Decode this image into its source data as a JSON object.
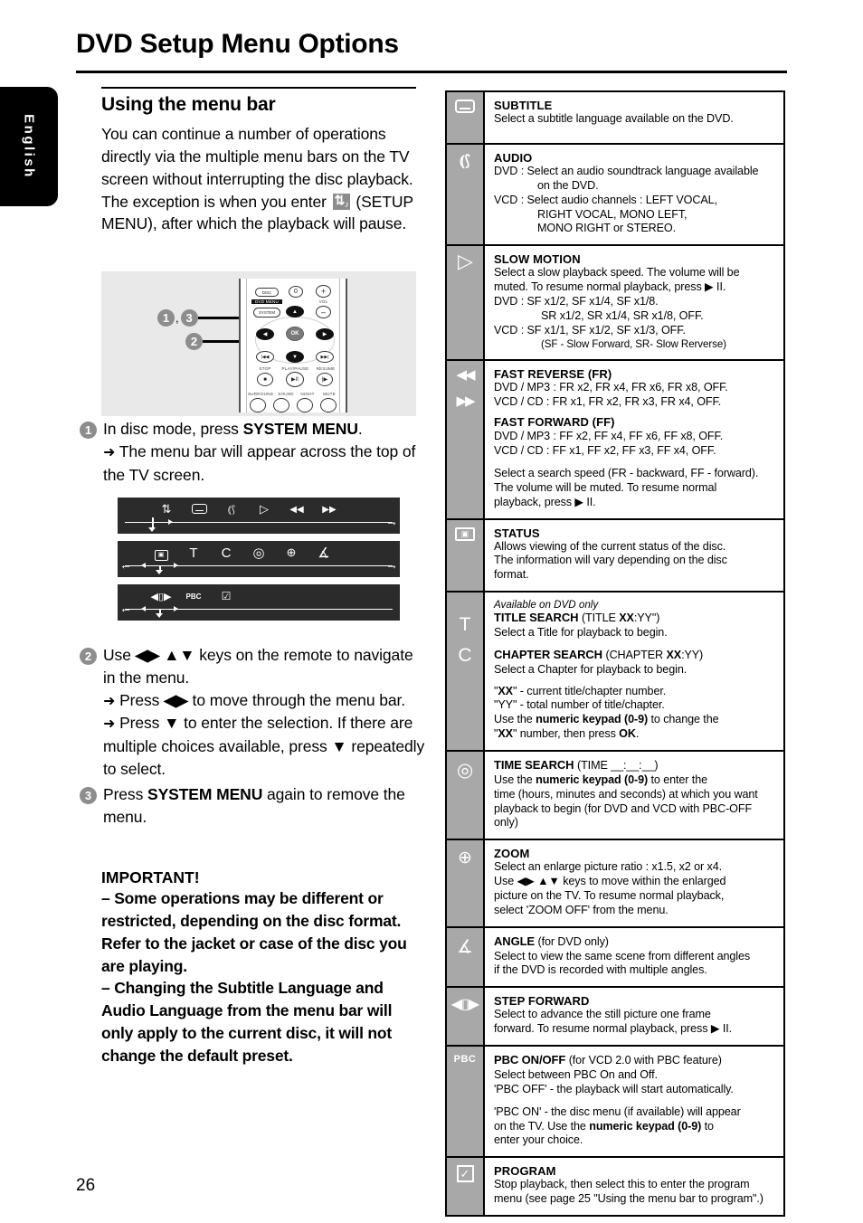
{
  "page": {
    "title": "DVD Setup Menu Options",
    "language_tab": "English",
    "page_number": "26"
  },
  "left": {
    "heading": "Using the menu bar",
    "intro_part1": "You can continue a number of operations directly via the multiple menu bars on the TV screen without interrupting the disc playback. The exception is when you enter ",
    "intro_icon": "setup-menu-icon",
    "intro_part2": " (SETUP MENU), after which the playback will pause.",
    "steps": [
      {
        "num": "1",
        "lines": [
          "In disc mode, press SYSTEM MENU.",
          "→ The menu bar will appear across the top of the TV screen."
        ],
        "line1_plain": "In disc mode, press ",
        "line1_bold": "SYSTEM MENU",
        "line1_tail": ".",
        "sub1": "The menu bar will appear across the top of the TV screen."
      },
      {
        "num": "2",
        "line1_plain": "Use ",
        "line1_keys": "◀▶ ▲▼",
        "line1_tail": " keys on the remote to navigate in the menu.",
        "sub1_plain": "Press ",
        "sub1_keys": "◀▶",
        "sub1_tail": " to move through the menu bar.",
        "sub2_plain": "Press ",
        "sub2_keys": "▼",
        "sub2_tail": " to enter the selection.  If there are multiple choices available, press ▼ repeatedly to select."
      },
      {
        "num": "3",
        "line1_plain": "Press ",
        "line1_bold": "SYSTEM MENU",
        "line1_tail": " again to remove the menu."
      }
    ],
    "important": {
      "heading": "IMPORTANT!",
      "bullets": [
        "–  Some operations may be different or restricted, depending on the disc format. Refer to the jacket or case of the disc you are playing.",
        "–  Changing the Subtitle Language and Audio Language from the menu bar will only apply to the current disc, it will not change the default preset."
      ]
    },
    "remote_figure": {
      "callout_1_3": "1, 3",
      "callout_2": "2",
      "keys": {
        "disc": "DISC",
        "dvd_menu": "DVD MENU",
        "system": "SYSTEM",
        "zero": "0",
        "vol": "VOL",
        "vol_plus": "+",
        "vol_minus": "–",
        "ok": "OK",
        "up": "▲",
        "down": "▼",
        "left": "◀",
        "right": "▶",
        "prev": "|◀◀",
        "next": "▶▶|",
        "stop_label": "STOP",
        "play_label": "PLAY/PAUSE",
        "resume_label": "RESUME",
        "stop": "■",
        "playpause": "▶II",
        "resume": "|▶",
        "surround": "SURROUND",
        "sound": "SOUND",
        "night": "NIGHT",
        "mute": "MUTE"
      }
    },
    "menu_bars": [
      {
        "icons": [
          "setup-menu-icon",
          "subtitle-icon",
          "audio-icon",
          "slow-motion-icon",
          "fast-reverse-icon",
          "fast-forward-icon"
        ],
        "glyphs": [
          "⇅",
          "▭",
          "((",
          "▷",
          "◀◀",
          "▶▶"
        ]
      },
      {
        "icons": [
          "status-icon",
          "title-search-icon",
          "chapter-search-icon",
          "time-search-icon",
          "zoom-icon",
          "angle-icon"
        ],
        "glyphs": [
          "◻",
          "T",
          "C",
          "◎",
          "⊕",
          "∡"
        ]
      },
      {
        "icons": [
          "step-forward-icon",
          "pbc-icon",
          "program-icon"
        ],
        "glyphs": [
          "◀▯▶",
          "PBC",
          "☑"
        ]
      }
    ]
  },
  "table": {
    "rows": [
      {
        "icons": [
          "subtitle-icon"
        ],
        "title": "SUBTITLE",
        "body": [
          {
            "type": "text",
            "text": "Select a subtitle language available on the DVD."
          }
        ]
      },
      {
        "icons": [
          "audio-icon"
        ],
        "title": "AUDIO",
        "body": [
          {
            "type": "text",
            "text": "DVD :  Select an audio soundtrack language available"
          },
          {
            "type": "indent",
            "text": "on the DVD."
          },
          {
            "type": "text",
            "text": "VCD :  Select audio channels : LEFT VOCAL,"
          },
          {
            "type": "indent",
            "text": "RIGHT VOCAL, MONO LEFT,"
          },
          {
            "type": "indent",
            "text": "MONO RIGHT or STEREO."
          }
        ]
      },
      {
        "icons": [
          "slow-motion-icon"
        ],
        "title": "SLOW MOTION",
        "body": [
          {
            "type": "text",
            "text": "Select a slow playback speed. The volume will be"
          },
          {
            "type": "text",
            "text": "muted.  To resume normal playback, press ▶ II."
          },
          {
            "type": "text",
            "text": "DVD :  SF x1/2, SF x1/4, SF x1/8."
          },
          {
            "type": "indent2",
            "text": "SR x1/2, SR x1/4, SR x1/8, OFF."
          },
          {
            "type": "text",
            "text": "VCD :  SF x1/1, SF x1/2, SF x1/3, OFF."
          },
          {
            "type": "indent3",
            "text": "(SF - Slow Forward, SR- Slow Rerverse)"
          }
        ]
      },
      {
        "icons": [
          "fast-reverse-icon",
          "fast-forward-icon"
        ],
        "title": "FAST REVERSE (FR)",
        "body": [
          {
            "type": "text",
            "text": "DVD / MP3 : FR x2, FR x4, FR x6, FR x8, OFF."
          },
          {
            "type": "text",
            "text": "VCD / CD : FR x1, FR x2, FR x3, FR x4, OFF."
          },
          {
            "type": "title",
            "text": "FAST FORWARD (FF)"
          },
          {
            "type": "text",
            "text": "DVD / MP3 : FF x2, FF x4, FF x6, FF x8, OFF."
          },
          {
            "type": "text",
            "text": "VCD / CD : FF x1, FF x2, FF x3, FF x4, OFF."
          },
          {
            "type": "gap",
            "text": ""
          },
          {
            "type": "text",
            "text": "Select a search speed (FR - backward, FF - forward)."
          },
          {
            "type": "text",
            "text": "The volume will be muted.  To resume normal"
          },
          {
            "type": "text",
            "text": "playback, press ▶ II."
          }
        ]
      },
      {
        "icons": [
          "status-icon"
        ],
        "title": "STATUS",
        "body": [
          {
            "type": "text",
            "text": "Allows viewing of the current status of the disc."
          },
          {
            "type": "text",
            "text": "The information will vary depending on the disc"
          },
          {
            "type": "text",
            "text": "format."
          }
        ]
      },
      {
        "icons": [
          "title-search-icon",
          "chapter-search-icon"
        ],
        "pretitle": "Available on DVD only",
        "title": "TITLE SEARCH (TITLE XX:YY\")",
        "title_html": "<b>TITLE SEARCH </b>(TITLE <b>XX</b>:YY\")",
        "body": [
          {
            "type": "text",
            "text": "Select a Title for playback to begin."
          },
          {
            "type": "gap",
            "text": ""
          },
          {
            "type": "html",
            "text": "<b>CHAPTER SEARCH </b>(CHAPTER <b>XX</b>:YY)"
          },
          {
            "type": "text",
            "text": "Select a Chapter for playback to begin."
          },
          {
            "type": "gap",
            "text": ""
          },
          {
            "type": "html",
            "text": "\"<b>XX</b>\" - current title/chapter number."
          },
          {
            "type": "text",
            "text": "\"YY\" - total number of title/chapter."
          },
          {
            "type": "html",
            "text": "Use the <b>numeric keypad (0-9)</b> to change the"
          },
          {
            "type": "html",
            "text": "\"<b>XX</b>\" number, then press <b>OK</b>."
          }
        ]
      },
      {
        "icons": [
          "time-search-icon"
        ],
        "title_html": "<b>TIME SEARCH </b>(TIME __:__:__)",
        "title": "TIME SEARCH (TIME __:__:__)",
        "body": [
          {
            "type": "html",
            "text": "Use the <b>numeric keypad (0-9)</b> to enter the"
          },
          {
            "type": "text",
            "text": "time (hours, minutes and seconds) at which you want"
          },
          {
            "type": "text",
            "text": "playback to begin (for DVD and VCD with PBC-OFF"
          },
          {
            "type": "text",
            "text": "only)"
          }
        ]
      },
      {
        "icons": [
          "zoom-icon"
        ],
        "title": "ZOOM",
        "body": [
          {
            "type": "text",
            "text": "Select an enlarge picture ratio : x1.5, x2 or x4."
          },
          {
            "type": "text",
            "text": "Use ◀▶ ▲▼ keys to move within the enlarged"
          },
          {
            "type": "text",
            "text": "picture on the TV. To resume normal playback,"
          },
          {
            "type": "text",
            "text": "select 'ZOOM OFF' from the menu."
          }
        ]
      },
      {
        "icons": [
          "angle-icon"
        ],
        "title_html": "<b>ANGLE </b>(for DVD only)",
        "title": "ANGLE (for DVD only)",
        "body": [
          {
            "type": "text",
            "text": "Select to view the same scene from different angles"
          },
          {
            "type": "text",
            "text": "if the DVD is recorded with multiple angles."
          }
        ]
      },
      {
        "icons": [
          "step-forward-icon"
        ],
        "title": "STEP FORWARD",
        "body": [
          {
            "type": "text",
            "text": "Select to advance the still picture one frame"
          },
          {
            "type": "text",
            "text": "forward. To resume normal playback, press ▶ II."
          }
        ]
      },
      {
        "icons": [
          "pbc-icon"
        ],
        "title_html": "<b>PBC ON/OFF </b>(for VCD 2.0 with PBC feature)",
        "title": "PBC ON/OFF (for VCD 2.0 with PBC feature)",
        "body": [
          {
            "type": "text",
            "text": "Select between PBC On and Off."
          },
          {
            "type": "text",
            "text": "'PBC OFF' - the playback will start automatically."
          },
          {
            "type": "gap",
            "text": ""
          },
          {
            "type": "text",
            "text": "'PBC ON' - the disc menu (if available) will appear"
          },
          {
            "type": "html",
            "text": "on the TV. Use the <b>numeric keypad (0-9)</b> to"
          },
          {
            "type": "text",
            "text": "enter your choice."
          }
        ]
      },
      {
        "icons": [
          "program-icon"
        ],
        "title": "PROGRAM",
        "body": [
          {
            "type": "text",
            "text": "Stop playback, then select this to enter the program"
          },
          {
            "type": "text",
            "text": "menu (see page 25 \"Using the menu bar to program\".)"
          }
        ]
      }
    ]
  },
  "colors": {
    "icon_column_bg": "#a8a8a8",
    "menu_bar_bg": "#2b2b2b",
    "bullet_gray": "#8d8d8d",
    "figure_bg": "#e9e9e9",
    "tab_black": "#000000"
  }
}
